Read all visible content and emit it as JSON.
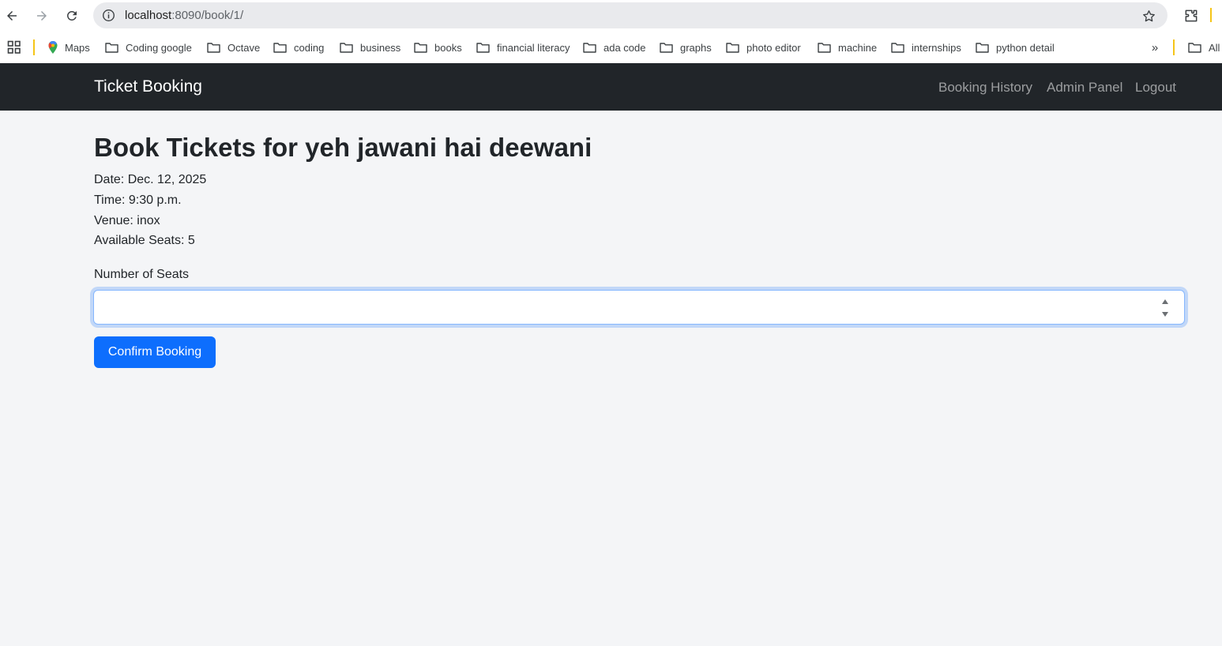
{
  "browser": {
    "url_host": "localhost",
    "url_rest": ":8090/book/1/",
    "bookmarks": [
      {
        "label": "Maps",
        "icon": "maps-icon"
      },
      {
        "label": "Coding google",
        "icon": "folder-icon"
      },
      {
        "label": "Octave",
        "icon": "folder-icon"
      },
      {
        "label": "coding",
        "icon": "folder-icon"
      },
      {
        "label": "business",
        "icon": "folder-icon"
      },
      {
        "label": "books",
        "icon": "folder-icon"
      },
      {
        "label": "financial literacy",
        "icon": "folder-icon"
      },
      {
        "label": "ada code",
        "icon": "folder-icon"
      },
      {
        "label": "graphs",
        "icon": "folder-icon"
      },
      {
        "label": "photo editor",
        "icon": "folder-icon"
      },
      {
        "label": "machine",
        "icon": "folder-icon"
      },
      {
        "label": "internships",
        "icon": "folder-icon"
      },
      {
        "label": "python detail",
        "icon": "folder-icon"
      }
    ],
    "more_bookmarks": "»",
    "all_bookmarks": "All"
  },
  "navbar": {
    "brand": "Ticket Booking",
    "links": [
      "Booking History",
      "Admin Panel",
      "Logout"
    ]
  },
  "page": {
    "title": "Book Tickets for yeh jawani hai deewani",
    "date": "Date: Dec. 12, 2025",
    "time": "Time: 9:30 p.m.",
    "venue": "Venue: inox",
    "available_seats": "Available Seats: 5",
    "seats_label": "Number of Seats",
    "seats_value": "",
    "confirm_label": "Confirm Booking"
  },
  "colors": {
    "navbar_bg": "#212529",
    "primary": "#0d6efd",
    "focus_border": "#86b7fe",
    "bookmark_separator": "#f5c518"
  }
}
